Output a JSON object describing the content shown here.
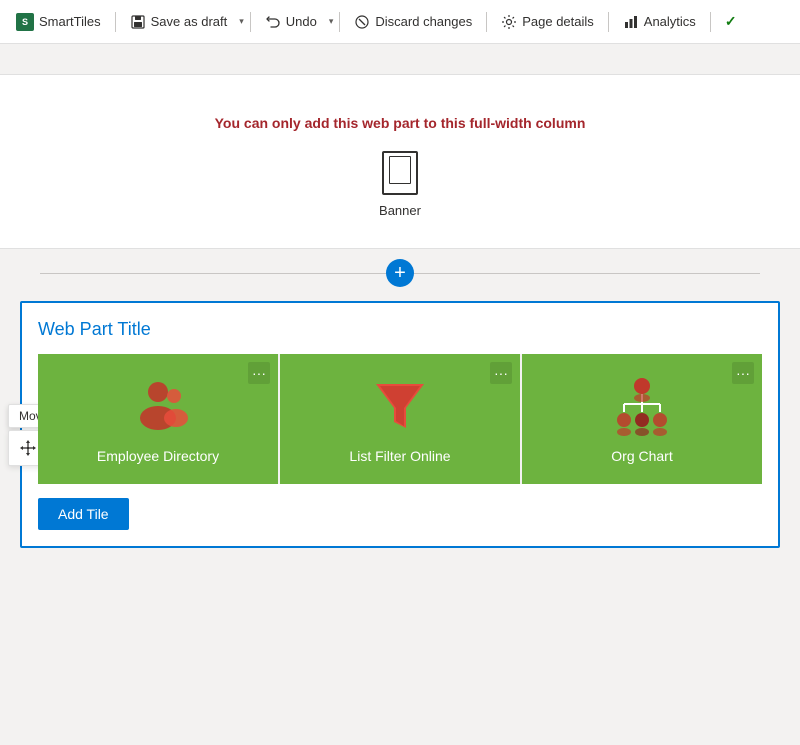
{
  "toolbar": {
    "smarttiles_label": "SmartTiles",
    "save_as_draft_label": "Save as draft",
    "undo_label": "Undo",
    "discard_changes_label": "Discard changes",
    "page_details_label": "Page details",
    "analytics_label": "Analytics",
    "check_label": "✓"
  },
  "canvas": {
    "full_width_notice": "You can only add this web part to this full-width column",
    "banner_label": "Banner"
  },
  "floating_toolbar": {
    "move_tooltip": "Move web part"
  },
  "webpart": {
    "title": "Web Part Title",
    "add_tile_label": "Add Tile",
    "tiles": [
      {
        "label": "Employee Directory"
      },
      {
        "label": "List Filter Online"
      },
      {
        "label": "Org Chart"
      }
    ]
  }
}
